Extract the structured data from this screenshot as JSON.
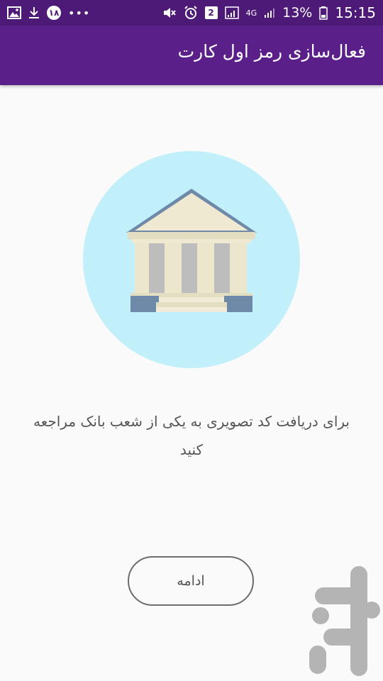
{
  "status_bar": {
    "notification_count": "۱۸",
    "sim_badge": "2",
    "network": "4G",
    "battery": "13%",
    "time": "15:15"
  },
  "app_bar": {
    "title": "فعال‌سازی رمز اول کارت"
  },
  "illustration": {
    "icon": "bank-building-icon",
    "circle_color": "#c1f0fa",
    "roof_color": "#6f8aa8",
    "column_color": "#ebe6cc",
    "base_color": "#6f8aa8"
  },
  "message": {
    "text": "برای دریافت کد تصویری به یکی از شعب بانک مراجعه کنید"
  },
  "continue_button": {
    "label": "ادامه"
  },
  "colors": {
    "app_bar": "#5b1f8a",
    "status_bar": "#4e1a77",
    "watermark": "#b4b4b4"
  }
}
